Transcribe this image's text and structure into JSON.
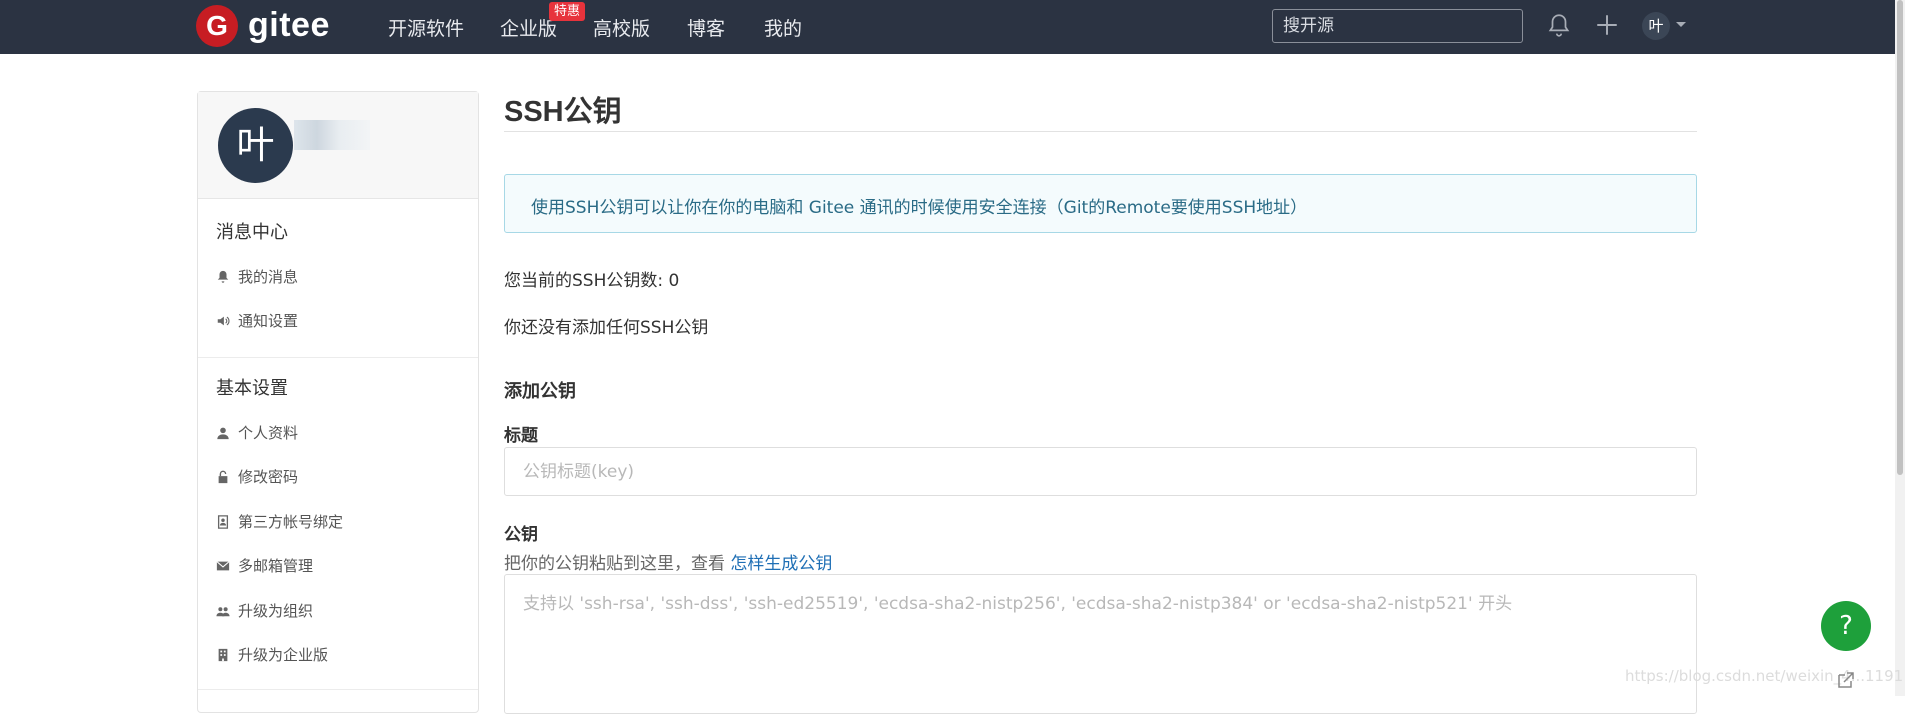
{
  "header": {
    "logo_mark": "G",
    "logo_text": "gitee",
    "nav": [
      {
        "label": "开源软件"
      },
      {
        "label": "企业版"
      },
      {
        "label": "高校版"
      },
      {
        "label": "博客"
      },
      {
        "label": "我的"
      }
    ],
    "badge": "特惠",
    "search_placeholder": "搜开源",
    "avatar_initial": "叶"
  },
  "sidebar": {
    "avatar_initial": "叶",
    "sections": [
      {
        "title": "消息中心",
        "items": [
          {
            "label": "我的消息",
            "icon": "bell-icon"
          },
          {
            "label": "通知设置",
            "icon": "speaker-icon"
          }
        ]
      },
      {
        "title": "基本设置",
        "items": [
          {
            "label": "个人资料",
            "icon": "user-icon"
          },
          {
            "label": "修改密码",
            "icon": "lock-icon"
          },
          {
            "label": "第三方帐号绑定",
            "icon": "contact-icon"
          },
          {
            "label": "多邮箱管理",
            "icon": "envelope-icon"
          },
          {
            "label": "升级为组织",
            "icon": "group-icon"
          },
          {
            "label": "升级为企业版",
            "icon": "building-icon"
          }
        ]
      }
    ]
  },
  "main": {
    "title": "SSH公钥",
    "info": "使用SSH公钥可以让你在你的电脑和 Gitee 通讯的时候使用安全连接（Git的Remote要使用SSH地址）",
    "count_text": "您当前的SSH公钥数: 0",
    "empty_text": "你还没有添加任何SSH公钥",
    "add_title": "添加公钥",
    "title_label": "标题",
    "title_placeholder": "公钥标题(key)",
    "key_label": "公钥",
    "hint_prefix": "把你的公钥粘贴到这里，查看",
    "hint_link": "怎样生成公钥",
    "key_placeholder": "支持以 'ssh-rsa', 'ssh-dss', 'ssh-ed25519', 'ecdsa-sha2-nistp256', 'ecdsa-sha2-nistp384' or 'ecdsa-sha2-nistp521' 开头"
  },
  "help": {
    "label": "?"
  },
  "watermark": "https://blog.csdn.net/weixin_4...1191"
}
